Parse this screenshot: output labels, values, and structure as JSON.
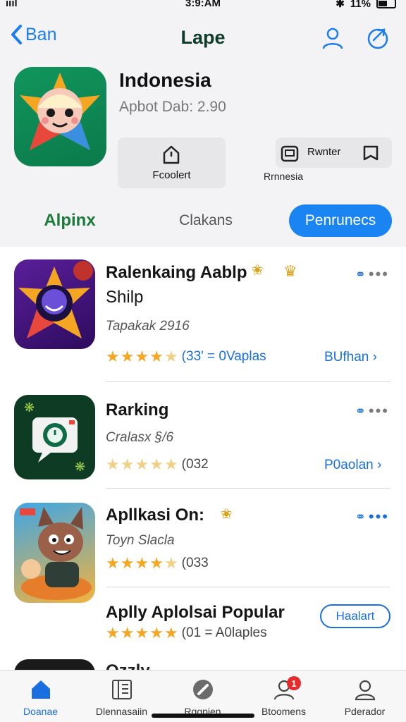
{
  "status_bar": {
    "signal": "ıııl",
    "time": "3:9:AM",
    "battery": "11%"
  },
  "nav": {
    "back_label": "Ban",
    "title": "Lape"
  },
  "hero": {
    "app_name": "Indonesia",
    "subtitle": "Apbot Dab: 2.90",
    "button_left_label": "Fcoolert",
    "button_right_label": "Rwnter",
    "button_right_sub": "Rrnnesia"
  },
  "segments": [
    "Alpinx",
    "Clakans",
    "Penrunecs"
  ],
  "apps": [
    {
      "title_line1": "Ralenkaing Aablp",
      "title_line2": "Shilp",
      "subtitle": "Tapakak 2916",
      "rating_count": "(33' = 0Vaplas",
      "link": "BUfhan ›"
    },
    {
      "title_line1": "Rarking",
      "subtitle": "Cralasx §/6",
      "rating_count": "(032",
      "link": "P0aolan ›"
    },
    {
      "title_line1": "Apllkasi On:",
      "subtitle": "Toyn Slacla",
      "rating_count": "(033"
    },
    {
      "title_line1": "Aplly Aplolsai Popular",
      "rating_count": "(01 = A0laples",
      "button": "Haalart"
    },
    {
      "title_line1": "Ozzly"
    }
  ],
  "tabs": [
    {
      "label": "Doanae",
      "icon": "home-icon"
    },
    {
      "label": "Dlennasaiin",
      "icon": "library-icon"
    },
    {
      "label": "Rggpien",
      "icon": "compass-icon"
    },
    {
      "label": "Btoomens",
      "icon": "users-icon",
      "badge": "1"
    },
    {
      "label": "Pderador",
      "icon": "profile-icon"
    }
  ],
  "colors": {
    "accent": "#1a84f3",
    "link": "#1a6fe0",
    "star": "#f5a623",
    "brand_green": "#0b7a4a",
    "badge": "#e52b2b"
  }
}
